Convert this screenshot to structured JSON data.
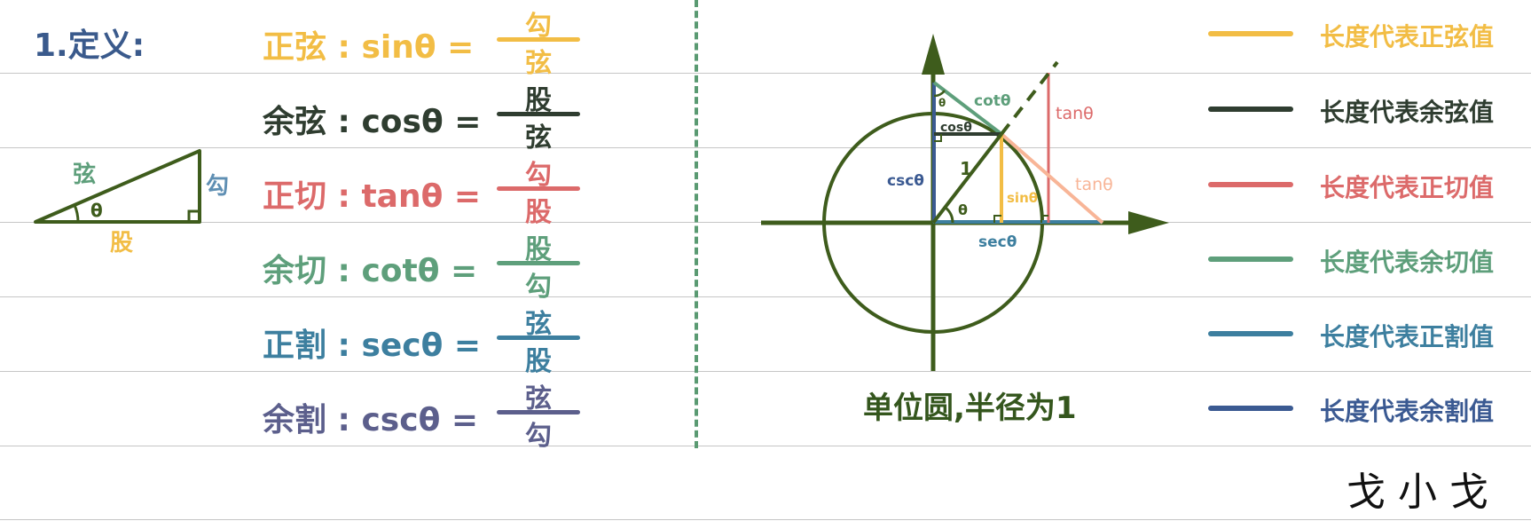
{
  "section_title": "1.定义:",
  "colors": {
    "sin": "#f2bd45",
    "cos": "#2f3d30",
    "tan": "#dc6a6a",
    "cot": "#5e9f7b",
    "sec": "#3d7f9f",
    "csc": "#3b5a92",
    "axis": "#3e5c1c",
    "tan_hyp": "#f8b597",
    "divider": "#5a9a72"
  },
  "triangle": {
    "hyp": "弦",
    "opp": "勾",
    "adj": "股",
    "angle": "θ"
  },
  "formulas": [
    {
      "key": "sin",
      "lhs": "正弦 : sinθ =",
      "num": "勾",
      "den": "弦"
    },
    {
      "key": "cos",
      "lhs": "余弦 : cosθ =",
      "num": "股",
      "den": "弦"
    },
    {
      "key": "tan",
      "lhs": "正切 : tanθ =",
      "num": "勾",
      "den": "股"
    },
    {
      "key": "cot",
      "lhs": "余切 : cotθ =",
      "num": "股",
      "den": "勾"
    },
    {
      "key": "sec",
      "lhs": "正割 : secθ =",
      "num": "弦",
      "den": "股"
    },
    {
      "key": "csc",
      "lhs": "余割 : cscθ =",
      "num": "弦",
      "den": "勾"
    }
  ],
  "circle": {
    "labels": {
      "cot": "cotθ",
      "tan_right": "tanθ",
      "cos": "cosθ",
      "csc": "cscθ",
      "radius": "1",
      "angle": "θ",
      "sin": "sinθ",
      "tan_hyp": "tanθ",
      "sec": "secθ",
      "top_angle": "θ"
    },
    "caption": "单位圆,半径为1"
  },
  "legend": [
    {
      "key": "sin",
      "label": "长度代表正弦值"
    },
    {
      "key": "cos",
      "label": "长度代表余弦值"
    },
    {
      "key": "tan",
      "label": "长度代表正切值"
    },
    {
      "key": "cot",
      "label": "长度代表余切值"
    },
    {
      "key": "sec",
      "label": "长度代表正割值"
    },
    {
      "key": "csc",
      "label": "长度代表余割值"
    }
  ],
  "signature": "戈小戈"
}
